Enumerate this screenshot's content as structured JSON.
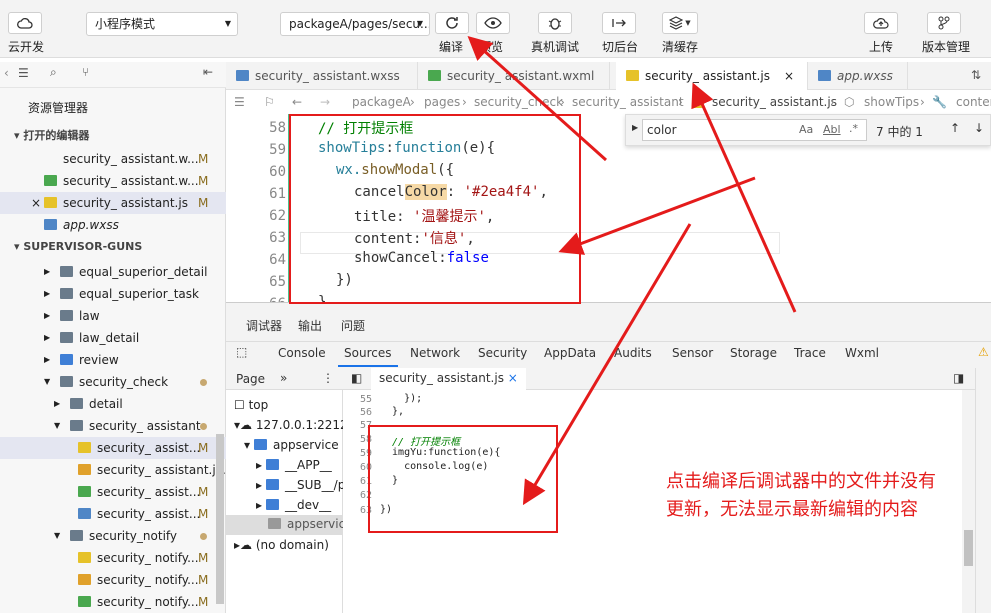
{
  "toolbar": {
    "cloud_label": "云开发",
    "mode_select": "小程序模式",
    "path_select": "packageA/pages/secu...",
    "compile_label": "编译",
    "preview_label": "预览",
    "remote_debug_label": "真机调试",
    "background_label": "切后台",
    "clear_cache_label": "清缓存",
    "upload_label": "上传",
    "version_label": "版本管理"
  },
  "explorer": {
    "title": "资源管理器",
    "open_editors_header": "打开的编辑器",
    "open_editors": [
      {
        "name": "security_ assistant.w...",
        "badge": "M"
      },
      {
        "name": "security_ assistant.w...",
        "badge": "M"
      },
      {
        "name": "security_ assistant.js",
        "badge": "M"
      },
      {
        "name": "app.wxss",
        "badge": ""
      }
    ],
    "project_header": "SUPERVISOR-GUNS",
    "tree": [
      {
        "name": "equal_superior_detail",
        "badge": ""
      },
      {
        "name": "equal_superior_task",
        "badge": ""
      },
      {
        "name": "law",
        "badge": ""
      },
      {
        "name": "law_detail",
        "badge": ""
      },
      {
        "name": "review",
        "badge": ""
      },
      {
        "name": "security_check",
        "badge": ""
      },
      {
        "name": "detail",
        "badge": ""
      },
      {
        "name": "security_ assistant",
        "badge": ""
      },
      {
        "name": "security_ assist...",
        "badge": "M"
      },
      {
        "name": "security_ assistant.js...",
        "badge": ""
      },
      {
        "name": "security_ assist...",
        "badge": "M"
      },
      {
        "name": "security_ assist...",
        "badge": "M"
      },
      {
        "name": "security_notify",
        "badge": ""
      },
      {
        "name": "security_ notify...",
        "badge": "M"
      },
      {
        "name": "security_ notify...",
        "badge": "M"
      },
      {
        "name": "security_ notify...",
        "badge": "M"
      }
    ]
  },
  "tabs": [
    {
      "label": "security_ assistant.wxss"
    },
    {
      "label": "security_ assistant.wxml"
    },
    {
      "label": "security_ assistant.js"
    },
    {
      "label": "app.wxss"
    }
  ],
  "breadcrumb": {
    "p1": "packageA",
    "p2": "pages",
    "p3": "security_check",
    "p4": "security_ assistant",
    "p5": "security_ assistant.js",
    "p6": "showTips",
    "p7": "conter"
  },
  "find": {
    "query": "color",
    "aa": "Aa",
    "ab": "Abl",
    "regex": ".*",
    "count": "7 中的 1"
  },
  "code": {
    "lines": [
      "58",
      "59",
      "60",
      "61",
      "62",
      "63",
      "64",
      "65",
      "66"
    ],
    "c58": "// 打开提示框",
    "c59a": "showTips",
    "c59b": ":",
    "c59c": "function",
    "c59d": "(e){",
    "c60a": "wx.",
    "c60b": "showModal",
    "c60c": "({",
    "c61a": "cancel",
    "c61b": "Color",
    "c61c": ": ",
    "c61d": "'#2ea4f4'",
    "c61e": ",",
    "c62a": "title",
    "c62b": ": ",
    "c62c": "'温馨提示'",
    "c62d": ",",
    "c63a": "content",
    "c63b": ":",
    "c63c": "'信息'",
    "c63d": ",",
    "c64a": "showCancel",
    "c64b": ":",
    "c64c": "false",
    "c65": "})",
    "c66": "}"
  },
  "debugger": {
    "top_tabs": [
      "调试器",
      "输出",
      "问题"
    ],
    "panel_tabs": [
      "Console",
      "Sources",
      "Network",
      "Security",
      "AppData",
      "Audits",
      "Sensor",
      "Storage",
      "Trace",
      "Wxml"
    ],
    "page_tab": "Page",
    "file_tab": "security_ assistant.js",
    "tree": [
      "top",
      "127.0.0.1:2212",
      "appservice",
      "__APP__",
      "__SUB__/p",
      "__dev__",
      "appservice",
      "(no domain)"
    ],
    "src_lines": [
      "55",
      "56",
      "57",
      "58",
      "59",
      "60",
      "61",
      "62",
      "63"
    ],
    "src": [
      "    });",
      "  },",
      "",
      "  // 打开提示框",
      "  imgYu:function(e){",
      "    console.log(e)",
      "  }",
      "",
      "})"
    ]
  },
  "annotation": {
    "line1": "点击编译后调试器中的文件并没有",
    "line2": "更新，无法显示最新编辑的内容"
  },
  "colors": {
    "accent": "#1aad19",
    "annotation": "#e41b1b"
  }
}
